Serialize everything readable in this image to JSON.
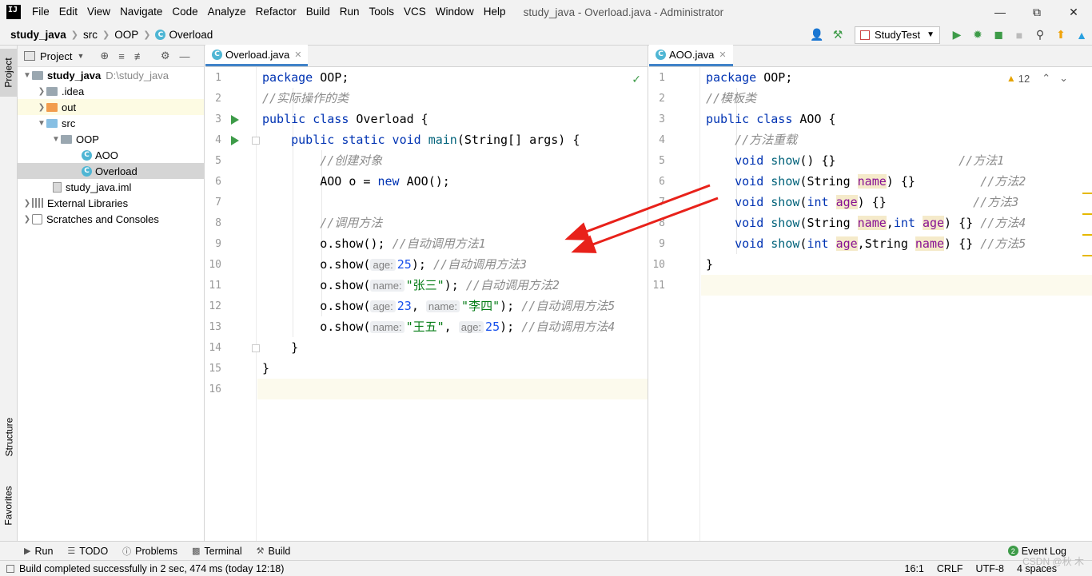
{
  "menu": {
    "items": [
      "File",
      "Edit",
      "View",
      "Navigate",
      "Code",
      "Analyze",
      "Refactor",
      "Build",
      "Run",
      "Tools",
      "VCS",
      "Window",
      "Help"
    ],
    "window_title": "study_java - Overload.java - Administrator"
  },
  "breadcrumb": {
    "root": "study_java",
    "src": "src",
    "pkg": "OOP",
    "cls": "Overload"
  },
  "toolbar": {
    "run_config": "StudyTest"
  },
  "sidebar": {
    "project_tab": "Project",
    "structure_tab": "Structure",
    "favorites_tab": "Favorites"
  },
  "project": {
    "header": "Project",
    "root_name": "study_java",
    "root_path": "D:\\study_java",
    "idea": ".idea",
    "out": "out",
    "src": "src",
    "oop": "OOP",
    "aoo": "AOO",
    "overload": "Overload",
    "iml": "study_java.iml",
    "ext_libs": "External Libraries",
    "scratches": "Scratches and Consoles"
  },
  "editor_left": {
    "tab": "Overload.java",
    "line_numbers": [
      "1",
      "2",
      "3",
      "4",
      "5",
      "6",
      "7",
      "8",
      "9",
      "10",
      "11",
      "12",
      "13",
      "14",
      "15",
      "16"
    ]
  },
  "editor_right": {
    "tab": "AOO.java",
    "warnings": "12",
    "line_numbers": [
      "1",
      "2",
      "3",
      "4",
      "5",
      "6",
      "7",
      "8",
      "9",
      "10",
      "11"
    ]
  },
  "code_left": {
    "l1_kw": "package",
    "l1_rest": " OOP;",
    "l2": "//实际操作的类",
    "l3_kw": "public class",
    "l3_rest": " Overload {",
    "l4_kw": "public static void",
    "l4_fn": "main",
    "l4_rest": "(String[] args) {",
    "l5": "//创建对象",
    "l6_a": "AOO o = ",
    "l6_kw": "new",
    "l6_b": " AOO();",
    "l8": "//调用方法",
    "l9_a": "o.show(); ",
    "l9_cm": "//自动调用方法1",
    "show_open": "o.show(",
    "hint_age": "age:",
    "hint_name": "name:",
    "l10_num": "25",
    "l10_close": "); ",
    "l10_cm": "//自动调用方法3",
    "l11_str": "\"张三\"",
    "l11_close": "); ",
    "l11_cm": "//自动调用方法2",
    "l12_num": "23",
    "comma": ", ",
    "l12_str": "\"李四\"",
    "l12_close": "); ",
    "l12_cm": "//自动调用方法5",
    "l13_str": "\"王五\"",
    "l13_num": "25",
    "l13_close": "); ",
    "l13_cm": "//自动调用方法4",
    "l14": "}",
    "l15": "}"
  },
  "code_right": {
    "l1_kw": "package",
    "l1_rest": " OOP;",
    "l2": "//模板类",
    "l3_kw": "public class",
    "l3_rest": " AOO {",
    "l4": "//方法重载",
    "void": "void",
    "show": "show",
    "l5_rest": "() {}",
    "l5_cm": "//方法1",
    "string": "String",
    "int": "int",
    "name": "name",
    "age": "age",
    "l6_cm": "//方法2",
    "l7_cm": "//方法3",
    "l8_cm": "//方法4",
    "l9_cm": "//方法5",
    "l10": "}"
  },
  "bottom_tools": {
    "run": "Run",
    "todo": "TODO",
    "problems": "Problems",
    "terminal": "Terminal",
    "build": "Build",
    "event_log": "Event Log",
    "event_count": "2"
  },
  "status": {
    "message": "Build completed successfully in 2 sec, 474 ms (today 12:18)",
    "position": "16:1",
    "line_sep": "CRLF",
    "encoding": "UTF-8",
    "indent": "4 spaces",
    "watermark": "CSDN @秋 木"
  },
  "colors": {
    "keyword": "#0033b3",
    "comment": "#8c8c8c",
    "string": "#067d17",
    "number": "#1750eb",
    "annotation_arrow": "#e8211a"
  }
}
